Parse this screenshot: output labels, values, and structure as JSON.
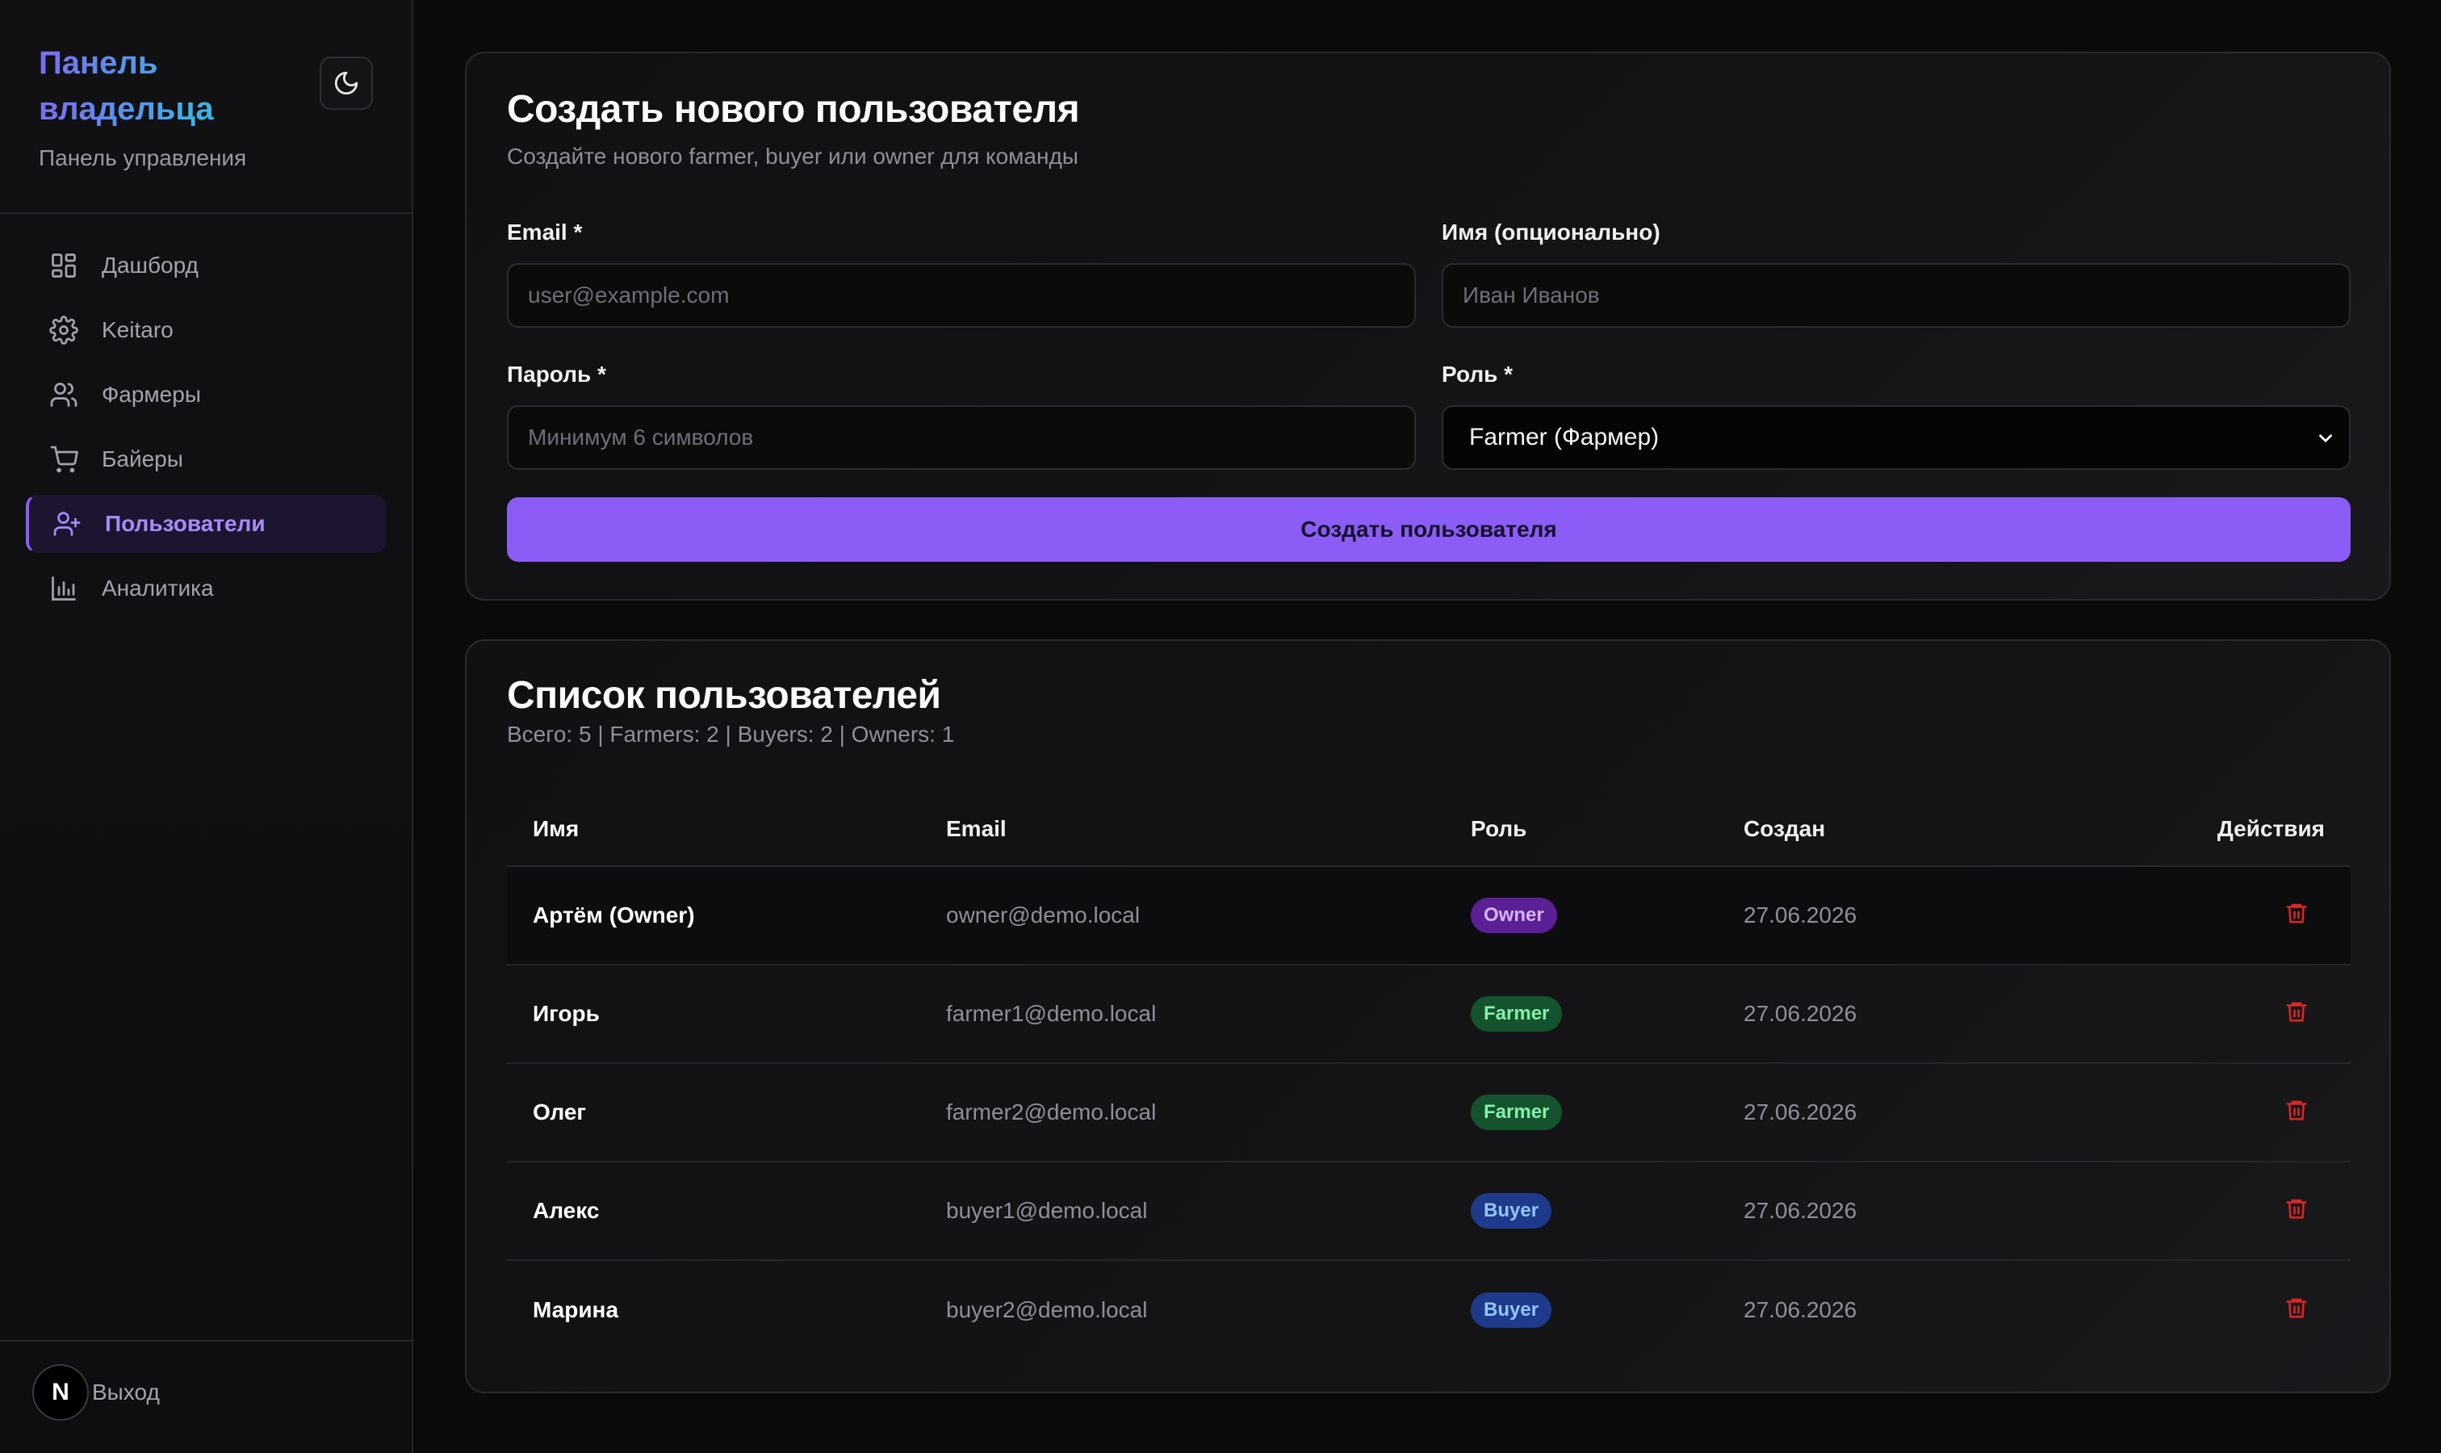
{
  "sidebar": {
    "brand_title": "Панель владельца",
    "brand_subtitle": "Панель управления",
    "items": [
      {
        "label": "Дашборд",
        "icon": "dashboard-grid-icon"
      },
      {
        "label": "Keitaro",
        "icon": "gear-icon"
      },
      {
        "label": "Фармеры",
        "icon": "users-icon"
      },
      {
        "label": "Байеры",
        "icon": "cart-icon"
      },
      {
        "label": "Пользователи",
        "icon": "user-plus-icon",
        "active": true
      },
      {
        "label": "Аналитика",
        "icon": "bar-chart-icon"
      }
    ],
    "avatar_letter": "N",
    "logout_label": "Выход"
  },
  "create": {
    "title": "Создать нового пользователя",
    "subtitle": "Создайте нового farmer, buyer или owner для команды",
    "email_label": "Email *",
    "email_placeholder": "user@example.com",
    "name_label": "Имя (опционально)",
    "name_placeholder": "Иван Иванов",
    "password_label": "Пароль *",
    "password_placeholder": "Минимум 6 символов",
    "role_label": "Роль *",
    "role_value": "Farmer (Фармер)",
    "submit_label": "Создать пользователя"
  },
  "list": {
    "title": "Список пользователей",
    "summary": "Всего: 5 | Farmers: 2 | Buyers: 2 | Owners: 1",
    "columns": {
      "name": "Имя",
      "email": "Email",
      "role": "Роль",
      "created": "Создан",
      "actions": "Действия"
    },
    "rows": [
      {
        "name": "Артём (Owner)",
        "email": "owner@demo.local",
        "role": "Owner",
        "created": "27.06.2026"
      },
      {
        "name": "Игорь",
        "email": "farmer1@demo.local",
        "role": "Farmer",
        "created": "27.06.2026"
      },
      {
        "name": "Олег",
        "email": "farmer2@demo.local",
        "role": "Farmer",
        "created": "27.06.2026"
      },
      {
        "name": "Алекс",
        "email": "buyer1@demo.local",
        "role": "Buyer",
        "created": "27.06.2026"
      },
      {
        "name": "Марина",
        "email": "buyer2@demo.local",
        "role": "Buyer",
        "created": "27.06.2026"
      }
    ]
  },
  "colors": {
    "accent": "#8b5cf6",
    "owner_badge": "#5b1f96",
    "farmer_badge": "#14532d",
    "buyer_badge": "#1e3a8a",
    "delete": "#dc2626"
  }
}
